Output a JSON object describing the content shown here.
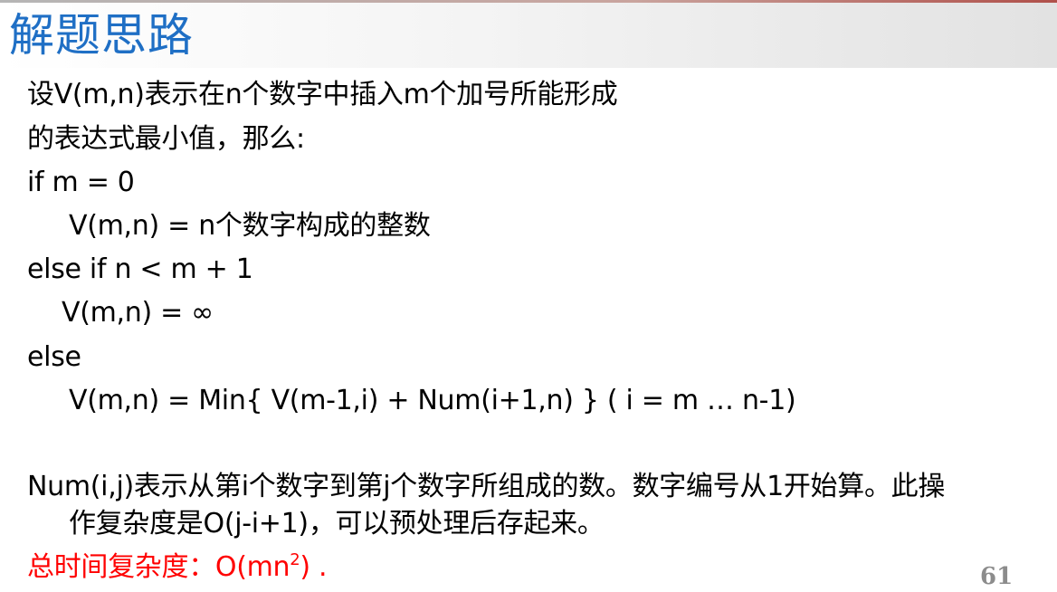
{
  "slide": {
    "title": "解题思路",
    "lines": [
      "设V(m,n)表示在n个数字中插入m个加号所能形成",
      "的表达式最小值，那么:",
      "if m = 0",
      "V(m,n) = n个数字构成的整数",
      "else if n < m + 1",
      "V(m,n) = ∞",
      "else",
      "V(m,n) = Min{  V(m-1,i) + Num(i+1,n) } ( i = m … n-1)",
      "Num(i,j)表示从第i个数字到第j个数字所组成的数。数字编号从1开始算。此操",
      "作复杂度是O(j-i+1)，可以预处理后存起来。"
    ],
    "complexity": {
      "prefix": "总时间复杂度：O(mn",
      "exponent": "2",
      "suffix": ") ."
    },
    "page_number": "61"
  },
  "colors": {
    "title": "#1f6fc5",
    "body_text": "#000000",
    "highlight": "#ff0000",
    "page_number": "#8c8c8c"
  }
}
